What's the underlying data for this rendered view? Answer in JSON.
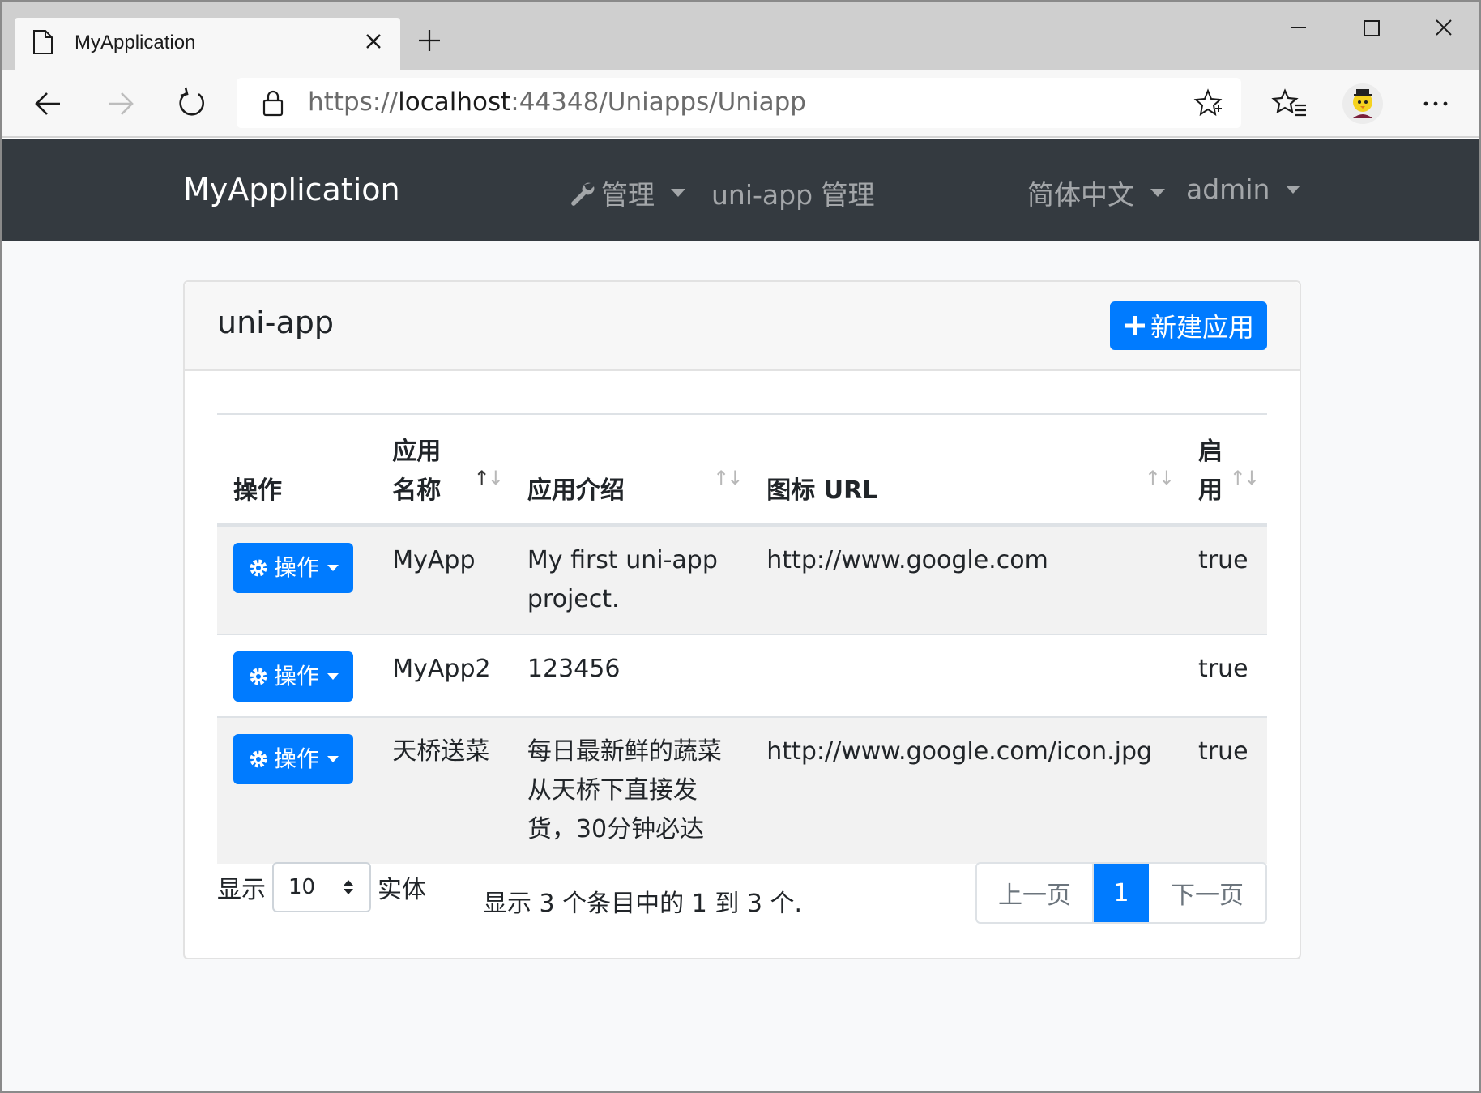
{
  "browser": {
    "tab_title": "MyApplication",
    "url_prefix": "https://",
    "url_host": "localhost",
    "url_rest": ":44348/Uniapps/Uniapp"
  },
  "navbar": {
    "brand": "MyApplication",
    "manage": "管理",
    "uniapp_manage": "uni-app 管理",
    "language": "简体中文",
    "user": "admin"
  },
  "card": {
    "title": "uni-app",
    "new_button": "新建应用"
  },
  "table": {
    "columns": [
      "操作",
      "应用名称",
      "应用介绍",
      "图标 URL",
      "启用"
    ],
    "rows": [
      {
        "action": "操作",
        "name": "MyApp",
        "description": "My first uni-app project.",
        "icon_url": "http://www.google.com",
        "enabled": "true"
      },
      {
        "action": "操作",
        "name": "MyApp2",
        "description": "123456",
        "icon_url": "",
        "enabled": "true"
      },
      {
        "action": "操作",
        "name": "天桥送菜",
        "description": "每日最新鲜的蔬菜从天桥下直接发货，30分钟必达",
        "icon_url": "http://www.google.com/icon.jpg",
        "enabled": "true"
      }
    ]
  },
  "footer": {
    "show_label": "显示",
    "page_size": "10",
    "entries_label": "实体",
    "info": "显示 3 个条目中的 1 到 3 个.",
    "prev": "上一页",
    "current_page": "1",
    "next": "下一页"
  },
  "colors": {
    "primary": "#007bff",
    "navbar": "#343a40"
  }
}
